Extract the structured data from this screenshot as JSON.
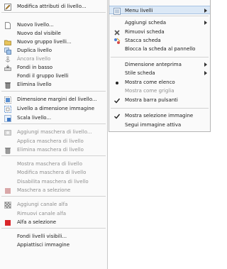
{
  "left_menu": {
    "items": [
      {
        "label": "Modifica attributi di livello...",
        "icon": "edit-icon",
        "disabled": false
      },
      {
        "label": "Nuovo livello...",
        "icon": "new-layer-icon",
        "disabled": false
      },
      {
        "label": "Nuovo dal visibile",
        "icon": "",
        "disabled": false
      },
      {
        "label": "Nuovo gruppo livelli...",
        "icon": "folder-icon",
        "disabled": false
      },
      {
        "label": "Duplica livello",
        "icon": "duplicate-icon",
        "disabled": false
      },
      {
        "label": "Àncora livello",
        "icon": "anchor-icon",
        "disabled": true
      },
      {
        "label": "Fondi in basso",
        "icon": "merge-down-icon",
        "disabled": false
      },
      {
        "label": "Fondi il gruppo livelli",
        "icon": "",
        "disabled": false
      },
      {
        "label": "Elimina livello",
        "icon": "trash-icon",
        "disabled": false
      },
      {
        "label": "Dimensione margini del livello...",
        "icon": "boundary-size-icon",
        "disabled": false
      },
      {
        "label": "Livello a dimensione immagine",
        "icon": "layer-to-image-icon",
        "disabled": false
      },
      {
        "label": "Scala livello...",
        "icon": "scale-icon",
        "disabled": false
      },
      {
        "label": "Aggiungi maschera di livello...",
        "icon": "add-mask-icon",
        "disabled": true
      },
      {
        "label": "Applica maschera di livello",
        "icon": "",
        "disabled": true
      },
      {
        "label": "Elimina maschera di livello",
        "icon": "delete-mask-icon",
        "disabled": true
      },
      {
        "label": "Mostra maschera di livello",
        "icon": "",
        "disabled": true
      },
      {
        "label": "Modifica maschera di livello",
        "icon": "",
        "disabled": true
      },
      {
        "label": "Disabilita maschera di livello",
        "icon": "",
        "disabled": true
      },
      {
        "label": "Maschera a selezione",
        "icon": "mask-selection-icon",
        "disabled": true
      },
      {
        "label": "Aggiungi canale alfa",
        "icon": "alpha-icon",
        "disabled": true
      },
      {
        "label": "Rimuovi canale alfa",
        "icon": "",
        "disabled": true
      },
      {
        "label": "Alfa a selezione",
        "icon": "alpha-selection-icon",
        "disabled": false
      },
      {
        "label": "Fondi livelli visibili...",
        "icon": "",
        "disabled": false
      },
      {
        "label": "Appiattisci immagine",
        "icon": "",
        "disabled": false
      }
    ]
  },
  "right_menu": {
    "items": [
      {
        "label": "Menu livelli",
        "icon": "menu-icon",
        "submenu": true,
        "disabled": false,
        "highlight": true
      },
      {
        "label": "Aggiungi scheda",
        "icon": "",
        "submenu": true,
        "disabled": false
      },
      {
        "label": "Rimuovi scheda",
        "icon": "close-x-icon",
        "submenu": false,
        "disabled": false
      },
      {
        "label": "Stacca scheda",
        "icon": "detach-icon",
        "submenu": false,
        "disabled": false
      },
      {
        "label": "Blocca la scheda al pannello",
        "icon": "",
        "submenu": false,
        "disabled": false
      },
      {
        "label": "Dimensione anteprima",
        "icon": "",
        "submenu": true,
        "disabled": false
      },
      {
        "label": "Stile scheda",
        "icon": "",
        "submenu": true,
        "disabled": false
      },
      {
        "label": "Mostra come elenco",
        "icon": "bullet-icon",
        "submenu": false,
        "disabled": false
      },
      {
        "label": "Mostra come griglia",
        "icon": "",
        "submenu": false,
        "disabled": true
      },
      {
        "label": "Mostra barra pulsanti",
        "icon": "check-icon",
        "submenu": false,
        "disabled": false
      },
      {
        "label": "Mostra selezione immagine",
        "icon": "check-icon",
        "submenu": false,
        "disabled": false
      },
      {
        "label": "Segui immagine attiva",
        "icon": "",
        "submenu": false,
        "disabled": false
      }
    ]
  },
  "colors": {
    "menu_bg": "#fafafa",
    "highlight_bg": "#dbe8f6",
    "disabled_text": "#8f8f8f",
    "delete_red": "#d9262a"
  }
}
